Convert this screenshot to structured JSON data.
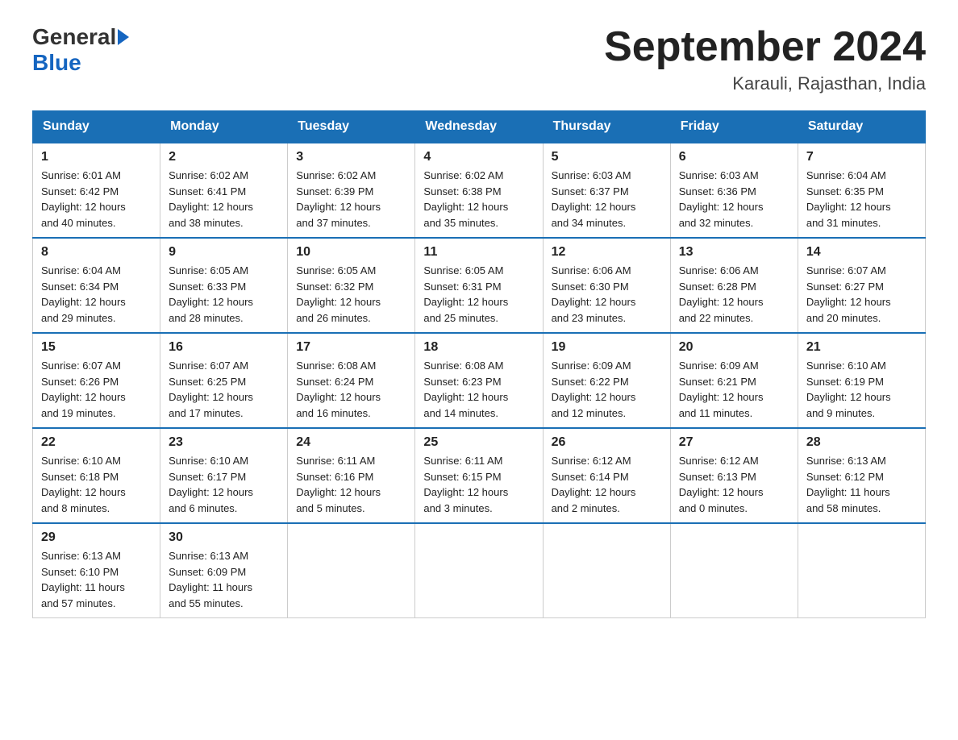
{
  "header": {
    "logo_text_general": "General",
    "logo_text_blue": "Blue",
    "month_title": "September 2024",
    "location": "Karauli, Rajasthan, India"
  },
  "days_of_week": [
    "Sunday",
    "Monday",
    "Tuesday",
    "Wednesday",
    "Thursday",
    "Friday",
    "Saturday"
  ],
  "weeks": [
    [
      {
        "day": "1",
        "sunrise": "6:01 AM",
        "sunset": "6:42 PM",
        "daylight": "12 hours and 40 minutes."
      },
      {
        "day": "2",
        "sunrise": "6:02 AM",
        "sunset": "6:41 PM",
        "daylight": "12 hours and 38 minutes."
      },
      {
        "day": "3",
        "sunrise": "6:02 AM",
        "sunset": "6:39 PM",
        "daylight": "12 hours and 37 minutes."
      },
      {
        "day": "4",
        "sunrise": "6:02 AM",
        "sunset": "6:38 PM",
        "daylight": "12 hours and 35 minutes."
      },
      {
        "day": "5",
        "sunrise": "6:03 AM",
        "sunset": "6:37 PM",
        "daylight": "12 hours and 34 minutes."
      },
      {
        "day": "6",
        "sunrise": "6:03 AM",
        "sunset": "6:36 PM",
        "daylight": "12 hours and 32 minutes."
      },
      {
        "day": "7",
        "sunrise": "6:04 AM",
        "sunset": "6:35 PM",
        "daylight": "12 hours and 31 minutes."
      }
    ],
    [
      {
        "day": "8",
        "sunrise": "6:04 AM",
        "sunset": "6:34 PM",
        "daylight": "12 hours and 29 minutes."
      },
      {
        "day": "9",
        "sunrise": "6:05 AM",
        "sunset": "6:33 PM",
        "daylight": "12 hours and 28 minutes."
      },
      {
        "day": "10",
        "sunrise": "6:05 AM",
        "sunset": "6:32 PM",
        "daylight": "12 hours and 26 minutes."
      },
      {
        "day": "11",
        "sunrise": "6:05 AM",
        "sunset": "6:31 PM",
        "daylight": "12 hours and 25 minutes."
      },
      {
        "day": "12",
        "sunrise": "6:06 AM",
        "sunset": "6:30 PM",
        "daylight": "12 hours and 23 minutes."
      },
      {
        "day": "13",
        "sunrise": "6:06 AM",
        "sunset": "6:28 PM",
        "daylight": "12 hours and 22 minutes."
      },
      {
        "day": "14",
        "sunrise": "6:07 AM",
        "sunset": "6:27 PM",
        "daylight": "12 hours and 20 minutes."
      }
    ],
    [
      {
        "day": "15",
        "sunrise": "6:07 AM",
        "sunset": "6:26 PM",
        "daylight": "12 hours and 19 minutes."
      },
      {
        "day": "16",
        "sunrise": "6:07 AM",
        "sunset": "6:25 PM",
        "daylight": "12 hours and 17 minutes."
      },
      {
        "day": "17",
        "sunrise": "6:08 AM",
        "sunset": "6:24 PM",
        "daylight": "12 hours and 16 minutes."
      },
      {
        "day": "18",
        "sunrise": "6:08 AM",
        "sunset": "6:23 PM",
        "daylight": "12 hours and 14 minutes."
      },
      {
        "day": "19",
        "sunrise": "6:09 AM",
        "sunset": "6:22 PM",
        "daylight": "12 hours and 12 minutes."
      },
      {
        "day": "20",
        "sunrise": "6:09 AM",
        "sunset": "6:21 PM",
        "daylight": "12 hours and 11 minutes."
      },
      {
        "day": "21",
        "sunrise": "6:10 AM",
        "sunset": "6:19 PM",
        "daylight": "12 hours and 9 minutes."
      }
    ],
    [
      {
        "day": "22",
        "sunrise": "6:10 AM",
        "sunset": "6:18 PM",
        "daylight": "12 hours and 8 minutes."
      },
      {
        "day": "23",
        "sunrise": "6:10 AM",
        "sunset": "6:17 PM",
        "daylight": "12 hours and 6 minutes."
      },
      {
        "day": "24",
        "sunrise": "6:11 AM",
        "sunset": "6:16 PM",
        "daylight": "12 hours and 5 minutes."
      },
      {
        "day": "25",
        "sunrise": "6:11 AM",
        "sunset": "6:15 PM",
        "daylight": "12 hours and 3 minutes."
      },
      {
        "day": "26",
        "sunrise": "6:12 AM",
        "sunset": "6:14 PM",
        "daylight": "12 hours and 2 minutes."
      },
      {
        "day": "27",
        "sunrise": "6:12 AM",
        "sunset": "6:13 PM",
        "daylight": "12 hours and 0 minutes."
      },
      {
        "day": "28",
        "sunrise": "6:13 AM",
        "sunset": "6:12 PM",
        "daylight": "11 hours and 58 minutes."
      }
    ],
    [
      {
        "day": "29",
        "sunrise": "6:13 AM",
        "sunset": "6:10 PM",
        "daylight": "11 hours and 57 minutes."
      },
      {
        "day": "30",
        "sunrise": "6:13 AM",
        "sunset": "6:09 PM",
        "daylight": "11 hours and 55 minutes."
      },
      null,
      null,
      null,
      null,
      null
    ]
  ],
  "labels": {
    "sunrise": "Sunrise:",
    "sunset": "Sunset:",
    "daylight": "Daylight:"
  }
}
